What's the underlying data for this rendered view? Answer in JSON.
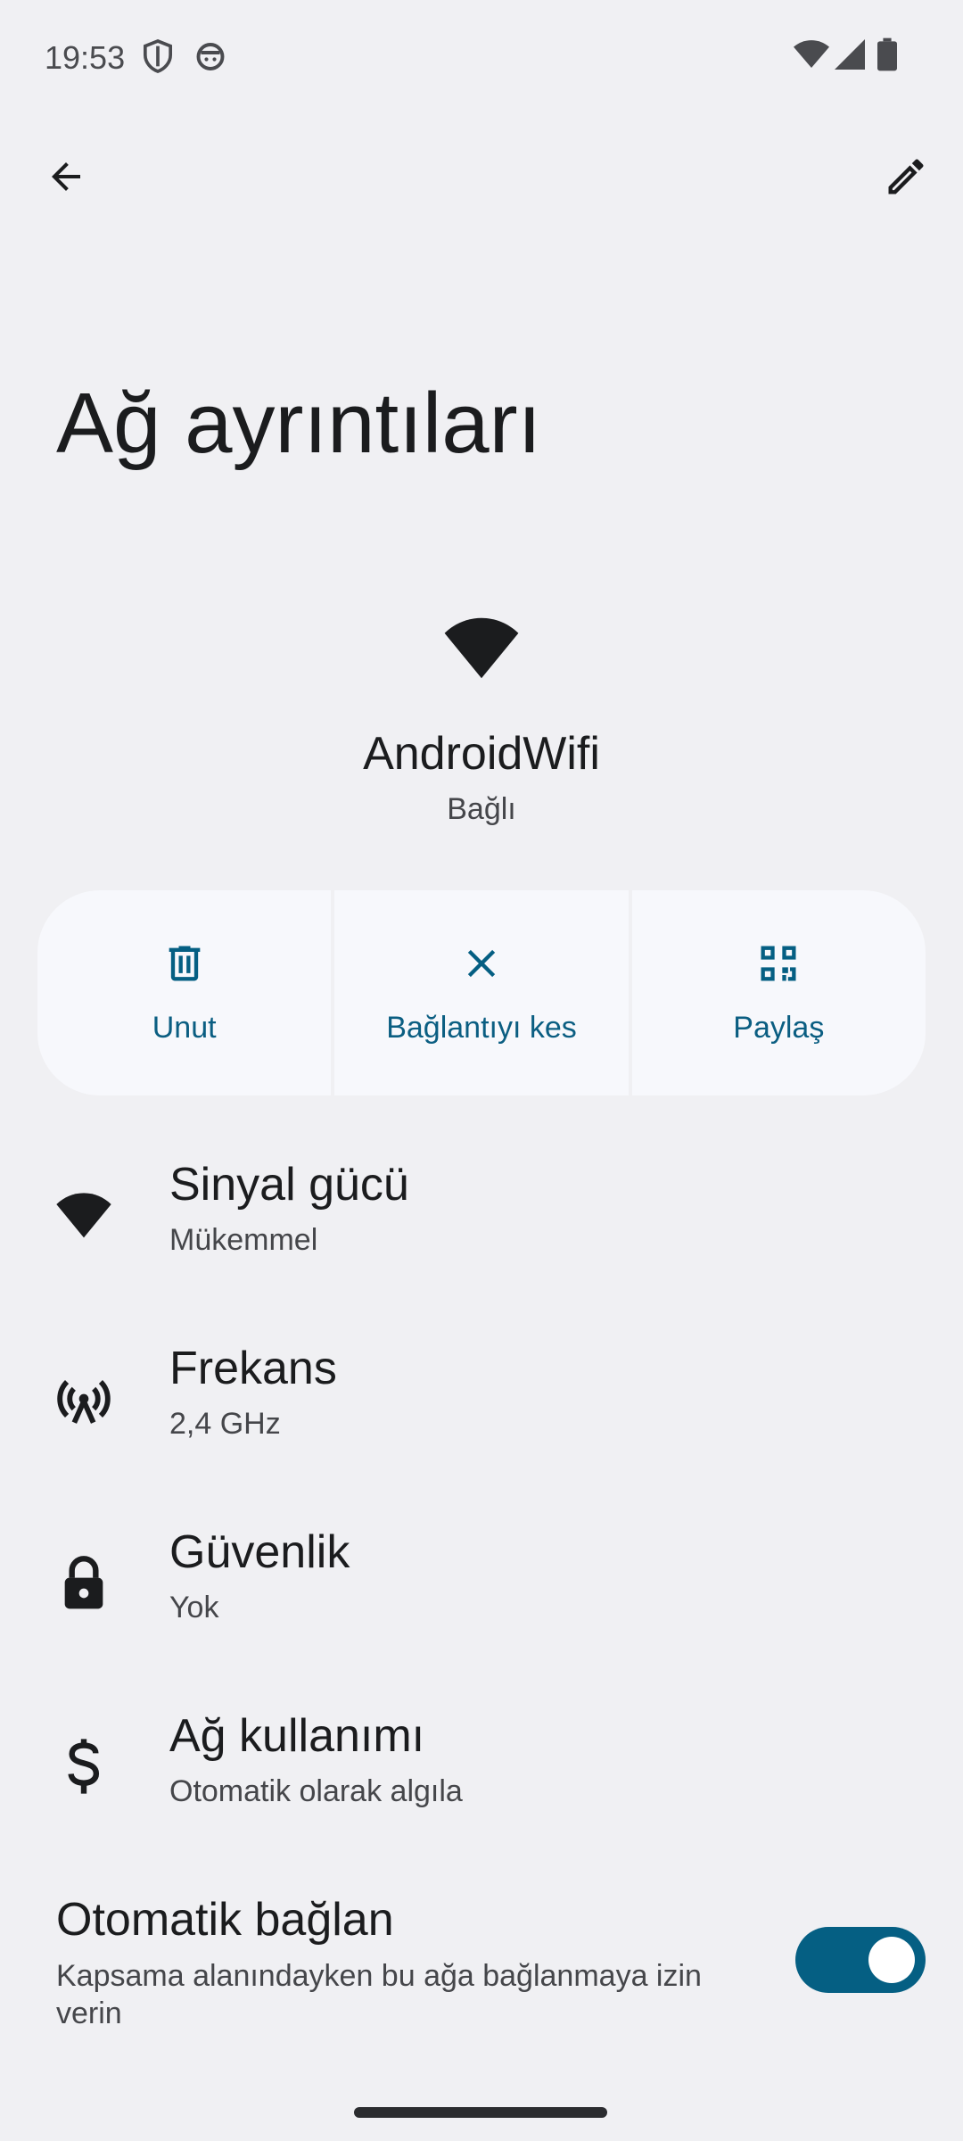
{
  "status_bar": {
    "time": "19:53",
    "icons": [
      "shield-icon",
      "android-face-icon",
      "wifi-signal-icon",
      "cell-signal-icon",
      "battery-icon"
    ]
  },
  "app_bar": {
    "back_icon": "arrow-left-icon",
    "edit_icon": "pencil-icon"
  },
  "page": {
    "title": "Ağ ayrıntıları"
  },
  "network": {
    "name": "AndroidWifi",
    "status": "Bağlı"
  },
  "actions": [
    {
      "label": "Unut",
      "icon": "trash-icon"
    },
    {
      "label": "Bağlantıyı kes",
      "icon": "close-icon"
    },
    {
      "label": "Paylaş",
      "icon": "qr-code-icon"
    }
  ],
  "details": [
    {
      "title": "Sinyal gücü",
      "subtitle": "Mükemmel",
      "icon": "wifi-icon"
    },
    {
      "title": "Frekans",
      "subtitle": "2,4 GHz",
      "icon": "antenna-icon"
    },
    {
      "title": "Güvenlik",
      "subtitle": "Yok",
      "icon": "lock-icon"
    },
    {
      "title": "Ağ kullanımı",
      "subtitle": "Otomatik olarak algıla",
      "icon": "dollar-icon"
    }
  ],
  "auto_connect": {
    "title": "Otomatik bağlan",
    "subtitle": "Kapsama alanındayken bu ağa bağlanmaya izin verin",
    "enabled": true
  },
  "colors": {
    "accent": "#055f83",
    "background": "#f0f0f3",
    "card": "#f7f8fc"
  }
}
